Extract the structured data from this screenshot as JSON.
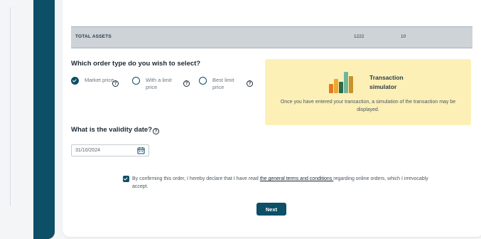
{
  "assets": {
    "label": "TOTAL ASSETS",
    "value1": "1222",
    "value2": "10"
  },
  "order_type": {
    "question": "Which order type do you wish to select?",
    "options": [
      {
        "label": "Market price",
        "selected": true
      },
      {
        "label": "With a limit price",
        "selected": false
      },
      {
        "label": "Best limit price",
        "selected": false
      }
    ],
    "help_symbol": "?"
  },
  "simulator": {
    "title": "Transaction simulator",
    "description": "Once you have entered your transaction, a simulation of the transaction may be displayed.",
    "icon": "bar-chart-icon",
    "bar_colors": [
      "#e07b1f",
      "#f2a531",
      "#2f6a4a",
      "#72b69a",
      "#c9922e"
    ]
  },
  "validity": {
    "question": "What is the validity date?",
    "help_symbol": "?",
    "date_value": "31/10/2024",
    "icon": "calendar-icon"
  },
  "consent": {
    "checked": true,
    "text_before": "By confirming this order, I hereby declare that I have read ",
    "link_text": "the general terms and conditions ",
    "text_after": "regarding online orders, which I irrevocably accept."
  },
  "next_label": "Next",
  "colors": {
    "primary": "#0c4f66",
    "simulator_bg": "#fdf0b7",
    "assets_bg": "#ced3d8"
  }
}
